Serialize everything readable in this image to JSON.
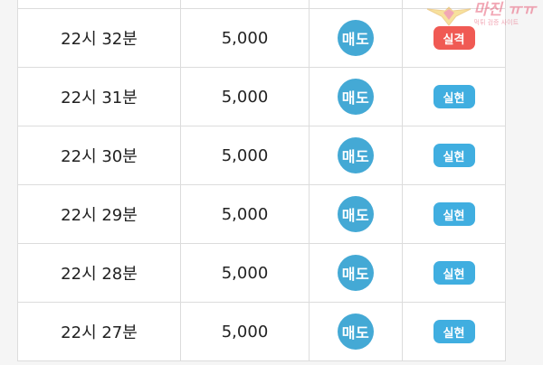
{
  "watermark": {
    "title": "마진 ㅠㅠ",
    "subtitle": "먹튀 검증 사이트"
  },
  "rows": [
    {
      "time": "",
      "amount": "",
      "action": "",
      "result": "",
      "status": "partial"
    },
    {
      "time": "22시 32분",
      "amount": "5,000",
      "action": "매도",
      "result": "실격",
      "status": "fail"
    },
    {
      "time": "22시 31분",
      "amount": "5,000",
      "action": "매도",
      "result": "실현",
      "status": "success"
    },
    {
      "time": "22시 30분",
      "amount": "5,000",
      "action": "매도",
      "result": "실현",
      "status": "success"
    },
    {
      "time": "22시 29분",
      "amount": "5,000",
      "action": "매도",
      "result": "실현",
      "status": "success"
    },
    {
      "time": "22시 28분",
      "amount": "5,000",
      "action": "매도",
      "result": "실현",
      "status": "success"
    },
    {
      "time": "22시 27분",
      "amount": "5,000",
      "action": "매도",
      "result": "실현",
      "status": "success"
    }
  ],
  "colors": {
    "action_badge": "#44a9d5",
    "success_badge": "#40aee0",
    "fail_badge": "#f05a54"
  }
}
